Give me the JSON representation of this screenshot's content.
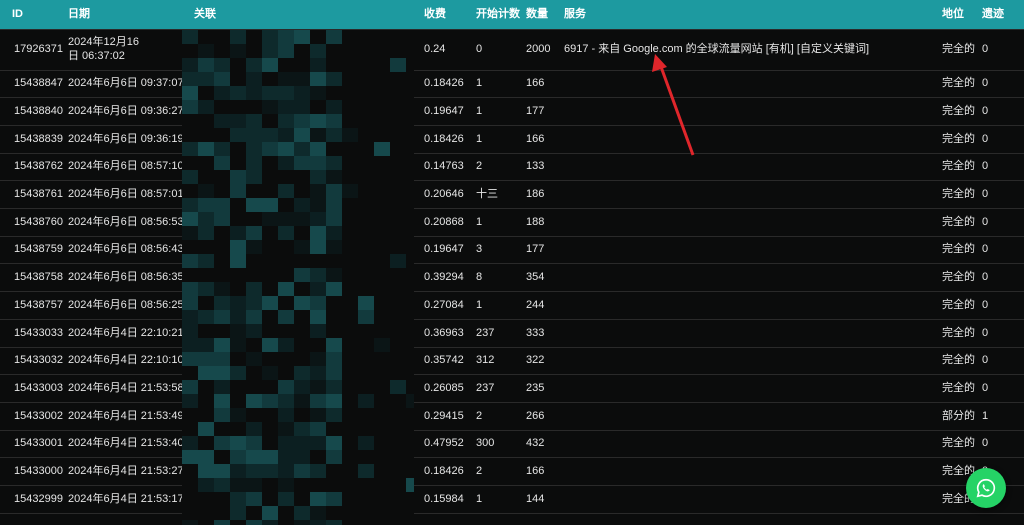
{
  "colors": {
    "header_bg": "#1d9aa0",
    "row_bg": "#0b0c0c",
    "accent_whatsapp": "#25d366",
    "arrow": "#e0262b"
  },
  "table": {
    "headers": [
      "ID",
      "日期",
      "关联",
      "收费",
      "开始计数",
      "数量",
      "服务",
      "地位",
      "遗迹"
    ],
    "rows": [
      {
        "id": "17926371",
        "date": "2024年12月16日 06:37:02",
        "charge": "0.24",
        "start": "0",
        "qty": "2000",
        "service": "6917 - 来自 Google.com 的全球流量网站 [有机] [自定义关键词]",
        "status": "完全的",
        "remains": "0"
      },
      {
        "id": "15438847",
        "date": "2024年6月6日 09:37:07",
        "charge": "0.18426",
        "start": "1",
        "qty": "166",
        "service": "",
        "status": "完全的",
        "remains": "0"
      },
      {
        "id": "15438840",
        "date": "2024年6月6日 09:36:27",
        "charge": "0.19647",
        "start": "1",
        "qty": "177",
        "service": "",
        "status": "完全的",
        "remains": "0"
      },
      {
        "id": "15438839",
        "date": "2024年6月6日 09:36:19",
        "charge": "0.18426",
        "start": "1",
        "qty": "166",
        "service": "",
        "status": "完全的",
        "remains": "0"
      },
      {
        "id": "15438762",
        "date": "2024年6月6日 08:57:10",
        "charge": "0.14763",
        "start": "2",
        "qty": "133",
        "service": "",
        "status": "完全的",
        "remains": "0"
      },
      {
        "id": "15438761",
        "date": "2024年6月6日 08:57:01",
        "charge": "0.20646",
        "start": "十三",
        "qty": "186",
        "service": "",
        "status": "完全的",
        "remains": "0"
      },
      {
        "id": "15438760",
        "date": "2024年6月6日 08:56:53",
        "charge": "0.20868",
        "start": "1",
        "qty": "188",
        "service": "",
        "status": "完全的",
        "remains": "0"
      },
      {
        "id": "15438759",
        "date": "2024年6月6日 08:56:43",
        "charge": "0.19647",
        "start": "3",
        "qty": "177",
        "service": "",
        "status": "完全的",
        "remains": "0"
      },
      {
        "id": "15438758",
        "date": "2024年6月6日 08:56:35",
        "charge": "0.39294",
        "start": "8",
        "qty": "354",
        "service": "",
        "status": "完全的",
        "remains": "0"
      },
      {
        "id": "15438757",
        "date": "2024年6月6日 08:56:25",
        "charge": "0.27084",
        "start": "1",
        "qty": "244",
        "service": "",
        "status": "完全的",
        "remains": "0"
      },
      {
        "id": "15433033",
        "date": "2024年6月4日 22:10:21",
        "charge": "0.36963",
        "start": "237",
        "qty": "333",
        "service": "",
        "status": "完全的",
        "remains": "0"
      },
      {
        "id": "15433032",
        "date": "2024年6月4日 22:10:10",
        "charge": "0.35742",
        "start": "312",
        "qty": "322",
        "service": "",
        "status": "完全的",
        "remains": "0"
      },
      {
        "id": "15433003",
        "date": "2024年6月4日 21:53:58",
        "charge": "0.26085",
        "start": "237",
        "qty": "235",
        "service": "",
        "status": "完全的",
        "remains": "0"
      },
      {
        "id": "15433002",
        "date": "2024年6月4日 21:53:49",
        "charge": "0.29415",
        "start": "2",
        "qty": "266",
        "service": "",
        "status": "部分的",
        "remains": "1"
      },
      {
        "id": "15433001",
        "date": "2024年6月4日 21:53:40",
        "charge": "0.47952",
        "start": "300",
        "qty": "432",
        "service": "",
        "status": "完全的",
        "remains": "0"
      },
      {
        "id": "15433000",
        "date": "2024年6月4日 21:53:27",
        "charge": "0.18426",
        "start": "2",
        "qty": "166",
        "service": "",
        "status": "完全的",
        "remains": "0"
      },
      {
        "id": "15432999",
        "date": "2024年6月4日 21:53:17",
        "charge": "0.15984",
        "start": "1",
        "qty": "144",
        "service": "",
        "status": "完全的",
        "remains": "0"
      }
    ]
  },
  "icons": {
    "whatsapp": "whatsapp-icon",
    "annotation": "red-arrow-icon"
  }
}
